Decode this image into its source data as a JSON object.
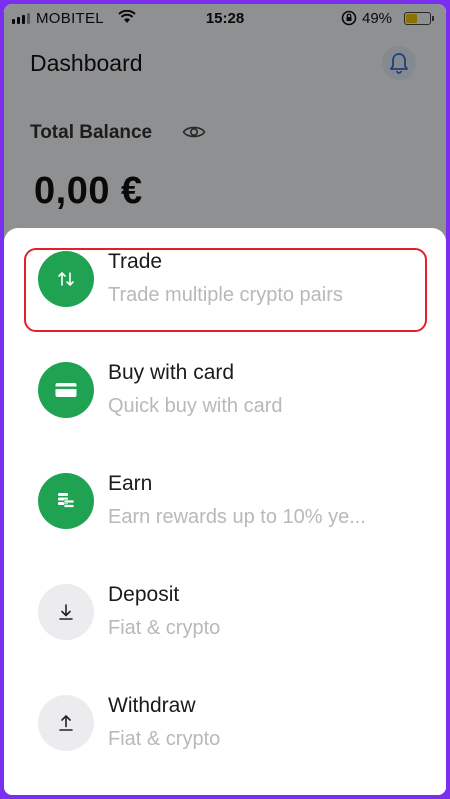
{
  "status_bar": {
    "carrier": "MOBITEL",
    "time": "15:28",
    "battery_percent": "49%",
    "battery_level": 0.49,
    "battery_color": "#f4c500"
  },
  "header": {
    "title": "Dashboard",
    "notification_icon": "bell-icon"
  },
  "balance": {
    "label": "Total Balance",
    "visibility_icon": "eye-icon",
    "value": "0,00 €"
  },
  "sheet": {
    "accent_color": "#1fa252",
    "highlight_color": "#e21f2a",
    "items": [
      {
        "title": "Trade",
        "subtitle": "Trade multiple crypto pairs",
        "icon": "swap-arrows-icon",
        "style": "green",
        "highlighted": true
      },
      {
        "title": "Buy with card",
        "subtitle": "Quick buy with card",
        "icon": "credit-card-icon",
        "style": "green"
      },
      {
        "title": "Earn",
        "subtitle": "Earn rewards up to 10% ye...",
        "icon": "coins-icon",
        "style": "green"
      },
      {
        "title": "Deposit",
        "subtitle": "Fiat & crypto",
        "icon": "download-icon",
        "style": "grey"
      },
      {
        "title": "Withdraw",
        "subtitle": "Fiat & crypto",
        "icon": "upload-icon",
        "style": "grey"
      }
    ]
  }
}
